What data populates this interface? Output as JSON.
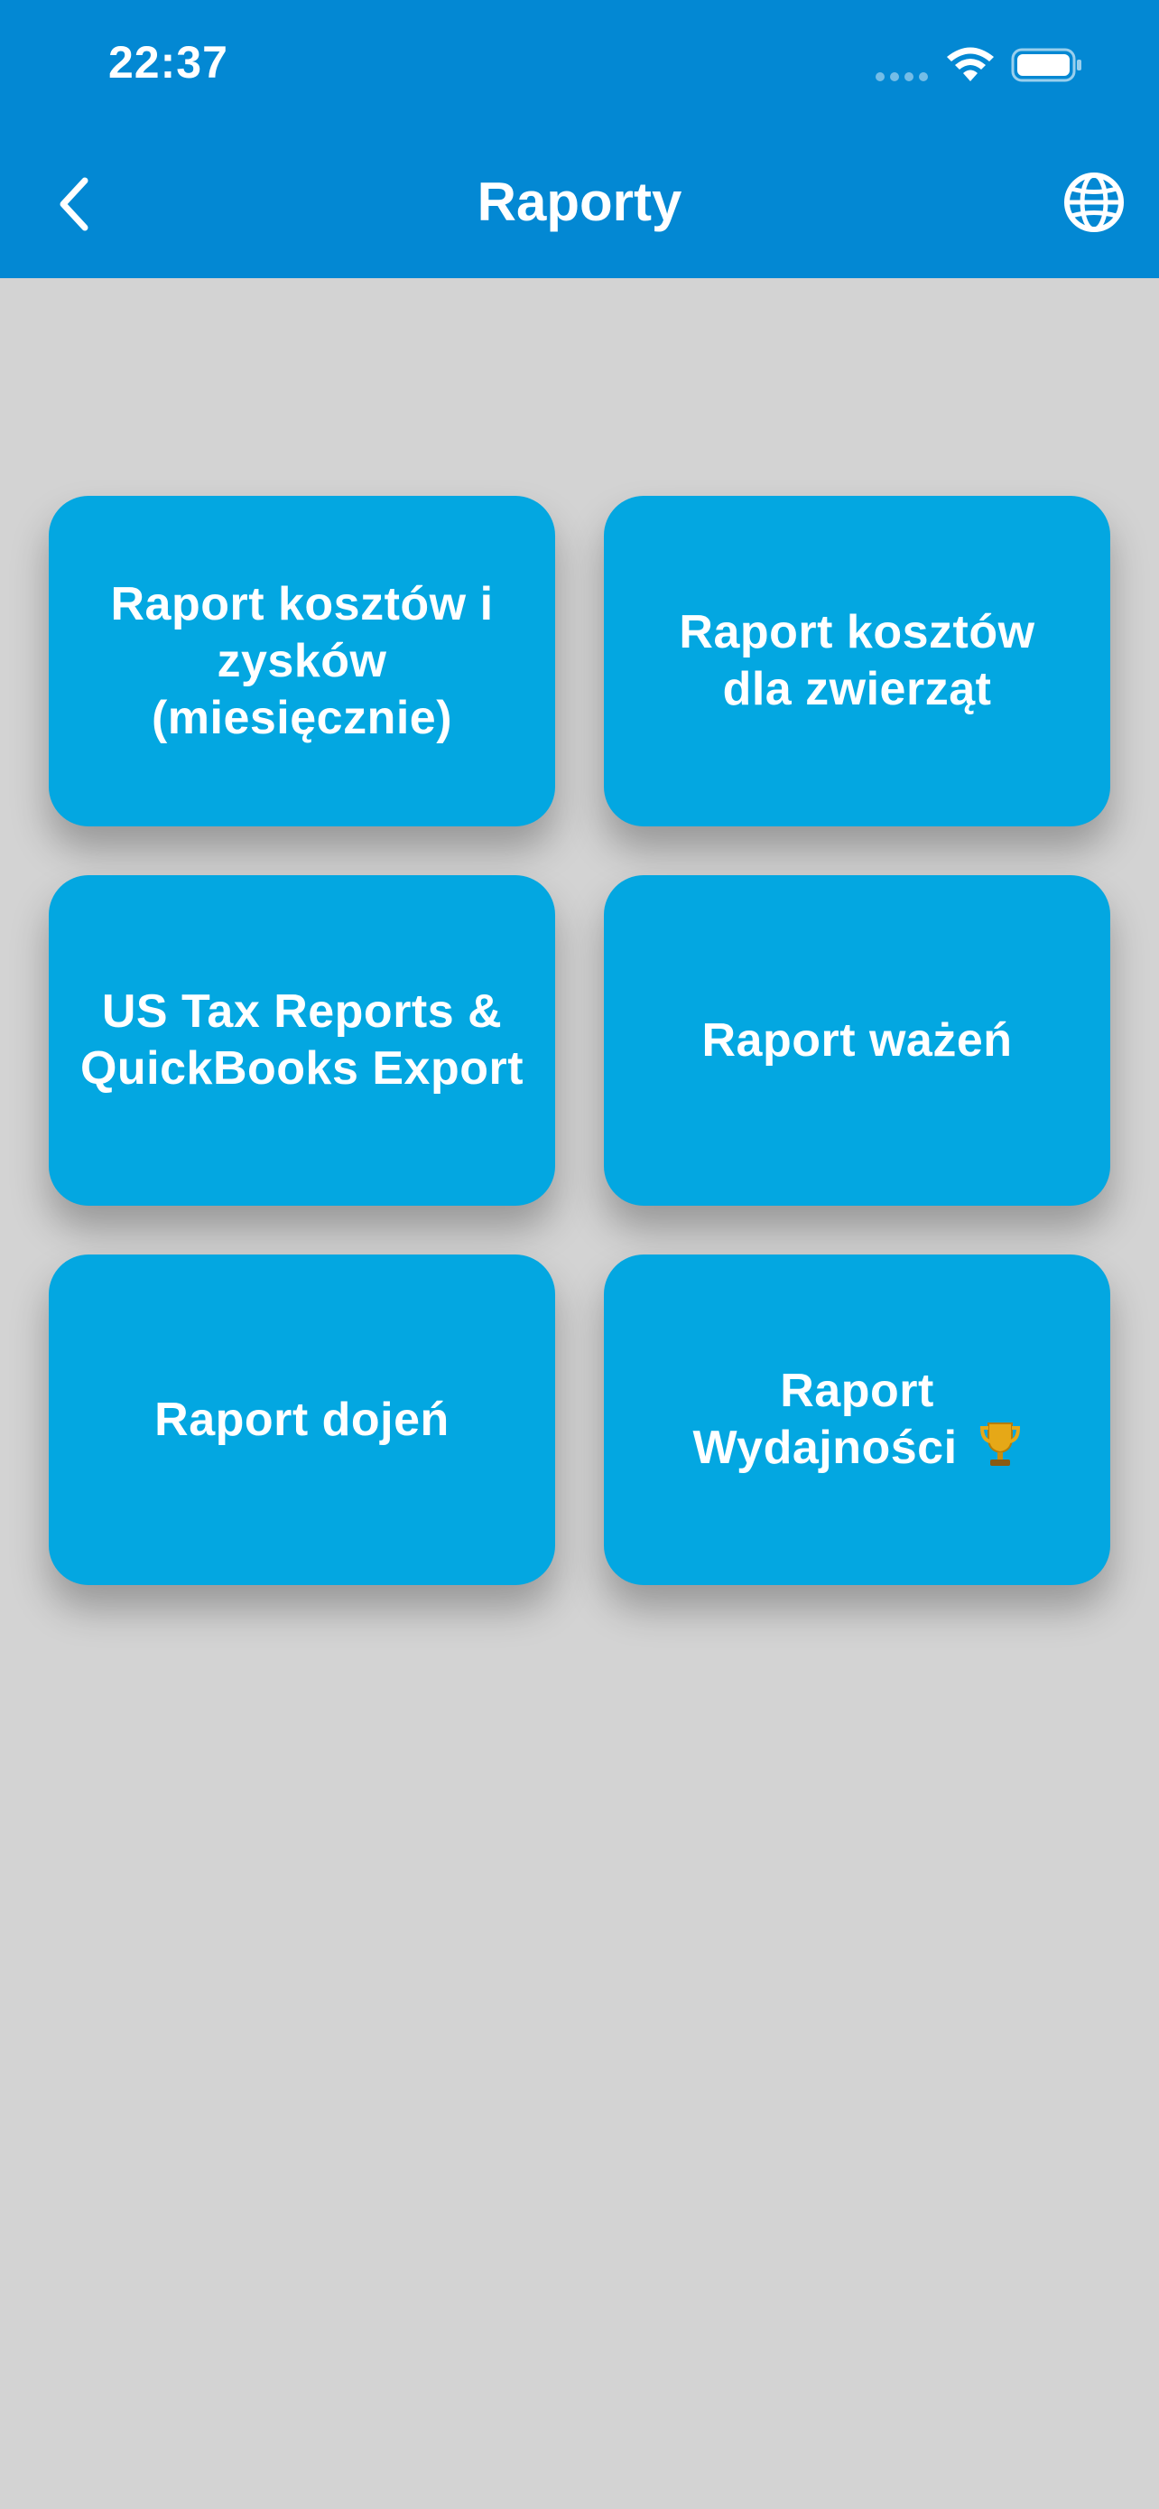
{
  "status_bar": {
    "time": "22:37"
  },
  "nav": {
    "title": "Raporty",
    "back_icon": "chevron-left-icon",
    "language_icon": "globe-icon"
  },
  "tiles": [
    {
      "label": "Raport kosztów i zysków (miesięcznie)"
    },
    {
      "label": "Raport kosztów dla zwierząt"
    },
    {
      "label": "US Tax Reports & QuickBooks Export"
    },
    {
      "label": "Raport ważeń"
    },
    {
      "label": "Raport dojeń"
    },
    {
      "label": "Raport Wydajności",
      "icon": "trophy-icon"
    }
  ],
  "colors": {
    "header": "#0388d3",
    "tile": "#03a7e1",
    "background": "#d3d3d3",
    "text": "#ffffff"
  }
}
